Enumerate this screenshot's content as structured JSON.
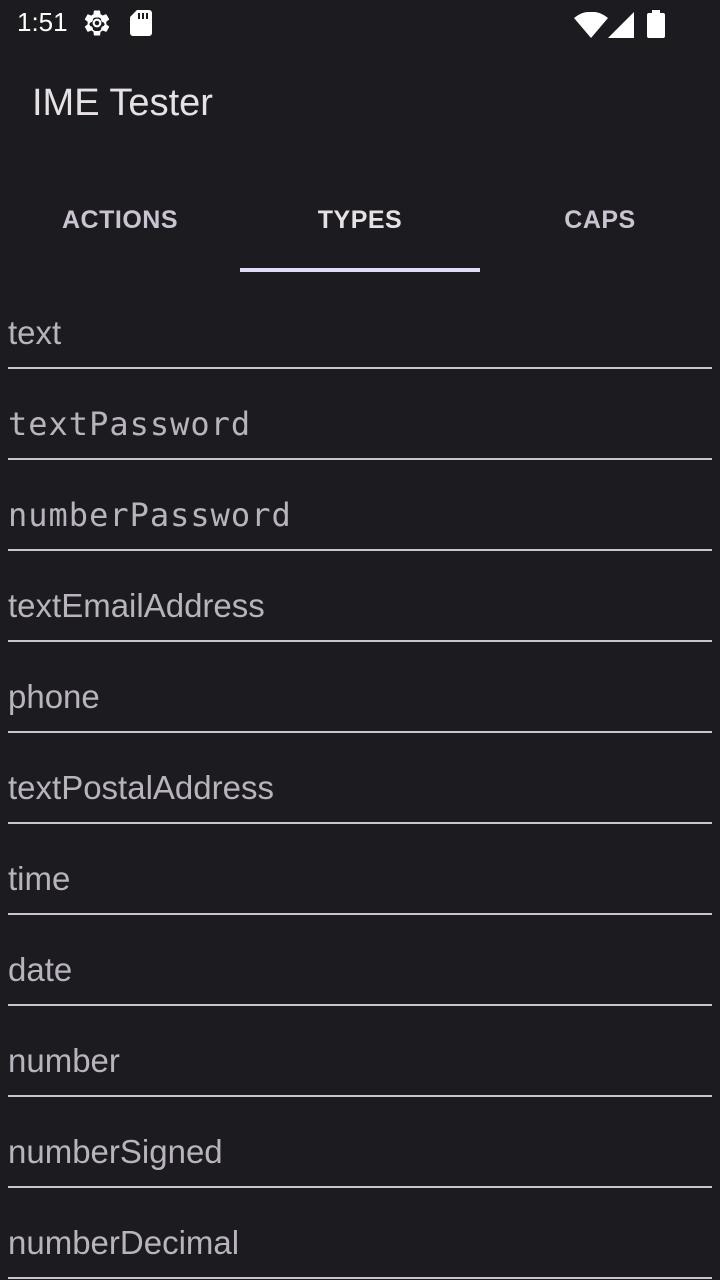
{
  "status_bar": {
    "time": "1:51",
    "icons": [
      "settings-gear-icon",
      "sd-card-icon",
      "wifi-icon",
      "cell-signal-icon",
      "battery-icon"
    ]
  },
  "app_bar": {
    "title": "IME Tester"
  },
  "tabs": [
    {
      "label": "ACTIONS",
      "active": false
    },
    {
      "label": "TYPES",
      "active": true
    },
    {
      "label": "CAPS",
      "active": false
    }
  ],
  "colors": {
    "background": "#1c1b20",
    "text": "#e6e1e5",
    "indicator": "#e0dcf5",
    "underline": "#cac4d0"
  },
  "fields": [
    {
      "placeholder": "text",
      "value": ""
    },
    {
      "placeholder": "textPassword",
      "value": ""
    },
    {
      "placeholder": "numberPassword",
      "value": ""
    },
    {
      "placeholder": "textEmailAddress",
      "value": ""
    },
    {
      "placeholder": "phone",
      "value": ""
    },
    {
      "placeholder": "textPostalAddress",
      "value": ""
    },
    {
      "placeholder": "time",
      "value": ""
    },
    {
      "placeholder": "date",
      "value": ""
    },
    {
      "placeholder": "number",
      "value": ""
    },
    {
      "placeholder": "numberSigned",
      "value": ""
    },
    {
      "placeholder": "numberDecimal",
      "value": ""
    }
  ]
}
